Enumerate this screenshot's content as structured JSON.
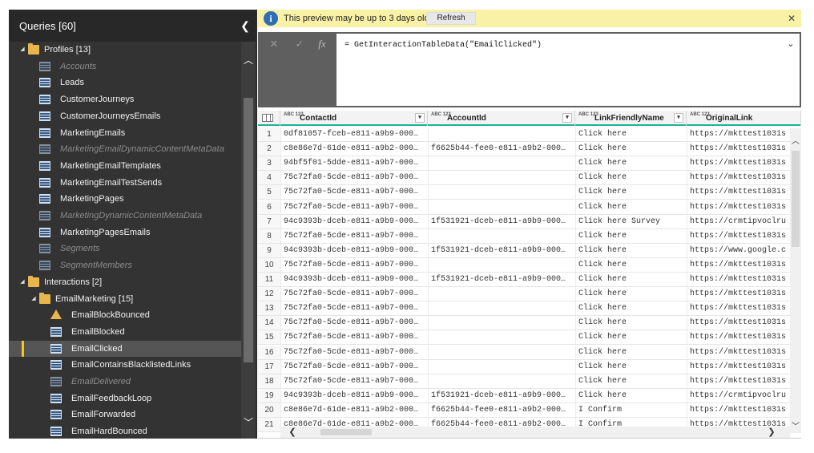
{
  "queries": {
    "title": "Queries [60]",
    "collapse_glyph": "❮",
    "items": [
      {
        "label": "Profiles [13]",
        "type": "folder",
        "depth": 0,
        "expanded": true,
        "disabled": false
      },
      {
        "label": "Accounts",
        "type": "table",
        "depth": 1,
        "disabled": true
      },
      {
        "label": "Leads",
        "type": "table",
        "depth": 1,
        "disabled": false
      },
      {
        "label": "CustomerJourneys",
        "type": "table",
        "depth": 1,
        "disabled": false
      },
      {
        "label": "CustomerJourneysEmails",
        "type": "table",
        "depth": 1,
        "disabled": false
      },
      {
        "label": "MarketingEmails",
        "type": "table",
        "depth": 1,
        "disabled": false
      },
      {
        "label": "MarketingEmailDynamicContentMetaData",
        "type": "table",
        "depth": 1,
        "disabled": true
      },
      {
        "label": "MarketingEmailTemplates",
        "type": "table",
        "depth": 1,
        "disabled": false
      },
      {
        "label": "MarketingEmailTestSends",
        "type": "table",
        "depth": 1,
        "disabled": false
      },
      {
        "label": "MarketingPages",
        "type": "table",
        "depth": 1,
        "disabled": false
      },
      {
        "label": "MarketingDynamicContentMetaData",
        "type": "table",
        "depth": 1,
        "disabled": true
      },
      {
        "label": "MarketingPagesEmails",
        "type": "table",
        "depth": 1,
        "disabled": false
      },
      {
        "label": "Segments",
        "type": "table",
        "depth": 1,
        "disabled": true
      },
      {
        "label": "SegmentMembers",
        "type": "table",
        "depth": 1,
        "disabled": true
      },
      {
        "label": "Interactions [2]",
        "type": "folder",
        "depth": 0,
        "expanded": true,
        "disabled": false
      },
      {
        "label": "EmailMarketing [15]",
        "type": "folder",
        "depth": 1,
        "expanded": true,
        "disabled": false
      },
      {
        "label": "EmailBlockBounced",
        "type": "warning",
        "depth": 2,
        "disabled": false
      },
      {
        "label": "EmailBlocked",
        "type": "table",
        "depth": 2,
        "disabled": false
      },
      {
        "label": "EmailClicked",
        "type": "table",
        "depth": 2,
        "disabled": false,
        "selected": true
      },
      {
        "label": "EmailContainsBlacklistedLinks",
        "type": "table",
        "depth": 2,
        "disabled": false
      },
      {
        "label": "EmailDelivered",
        "type": "table",
        "depth": 2,
        "disabled": true
      },
      {
        "label": "EmailFeedbackLoop",
        "type": "table",
        "depth": 2,
        "disabled": false
      },
      {
        "label": "EmailForwarded",
        "type": "table",
        "depth": 2,
        "disabled": false
      },
      {
        "label": "EmailHardBounced",
        "type": "table",
        "depth": 2,
        "disabled": false
      }
    ]
  },
  "infobar": {
    "icon": "info-icon",
    "icon_glyph": "i",
    "message": "This preview may be up to 3 days old.",
    "refresh_label": "Refresh",
    "close_glyph": "✕"
  },
  "formula": {
    "cancel_glyph": "✕",
    "commit_glyph": "✓",
    "fx_label": "fx",
    "text": "= GetInteractionTableData(\"EmailClicked\")",
    "expand_glyph": "⌄"
  },
  "grid": {
    "columns": [
      {
        "name": "ContactId",
        "type": "ABC 123"
      },
      {
        "name": "AccountId",
        "type": "ABC 123"
      },
      {
        "name": "LinkFriendlyName",
        "type": "ABC 123"
      },
      {
        "name": "OriginalLink",
        "type": "ABC 123"
      }
    ],
    "rows": [
      [
        "1",
        "0df81057-fceb-e811-a9b9-000…",
        "",
        "Click here",
        "https://mkttest1031s"
      ],
      [
        "2",
        "c8e86e7d-61de-e811-a9b2-000…",
        "f6625b44-fee0-e811-a9b2-000…",
        "Click here",
        "https://mkttest1031s"
      ],
      [
        "3",
        "94bf5f01-5dde-e811-a9b7-000…",
        "",
        "Click here",
        "https://mkttest1031s"
      ],
      [
        "4",
        "75c72fa0-5cde-e811-a9b7-000…",
        "",
        "Click here",
        "https://mkttest1031s"
      ],
      [
        "5",
        "75c72fa0-5cde-e811-a9b7-000…",
        "",
        "Click here",
        "https://mkttest1031s"
      ],
      [
        "6",
        "75c72fa0-5cde-e811-a9b7-000…",
        "",
        "Click here",
        "https://mkttest1031s"
      ],
      [
        "7",
        "94c9393b-dceb-e811-a9b9-000…",
        "1f531921-dceb-e811-a9b9-000…",
        "Click here Survey",
        "https://crmtipvoclru"
      ],
      [
        "8",
        "75c72fa0-5cde-e811-a9b7-000…",
        "",
        "Click here",
        "https://mkttest1031s"
      ],
      [
        "9",
        "94c9393b-dceb-e811-a9b9-000…",
        "1f531921-dceb-e811-a9b9-000…",
        "Click here",
        "https://www.google.c"
      ],
      [
        "10",
        "75c72fa0-5cde-e811-a9b7-000…",
        "",
        "Click here",
        "https://mkttest1031s"
      ],
      [
        "11",
        "94c9393b-dceb-e811-a9b9-000…",
        "1f531921-dceb-e811-a9b9-000…",
        "Click here",
        "https://mkttest1031s"
      ],
      [
        "12",
        "75c72fa0-5cde-e811-a9b7-000…",
        "",
        "Click here",
        "https://mkttest1031s"
      ],
      [
        "13",
        "75c72fa0-5cde-e811-a9b7-000…",
        "",
        "Click here",
        "https://mkttest1031s"
      ],
      [
        "14",
        "75c72fa0-5cde-e811-a9b7-000…",
        "",
        "Click here",
        "https://mkttest1031s"
      ],
      [
        "15",
        "75c72fa0-5cde-e811-a9b7-000…",
        "",
        "Click here",
        "https://mkttest1031s"
      ],
      [
        "16",
        "75c72fa0-5cde-e811-a9b7-000…",
        "",
        "Click here",
        "https://mkttest1031s"
      ],
      [
        "17",
        "75c72fa0-5cde-e811-a9b7-000…",
        "",
        "Click here",
        "https://mkttest1031s"
      ],
      [
        "18",
        "75c72fa0-5cde-e811-a9b7-000…",
        "",
        "Click here",
        "https://mkttest1031s"
      ],
      [
        "19",
        "94c9393b-dceb-e811-a9b9-000…",
        "1f531921-dceb-e811-a9b9-000…",
        "Click here",
        "https://crmtipvoclru"
      ],
      [
        "20",
        "c8e86e7d-61de-e811-a9b2-000…",
        "f6625b44-fee0-e811-a9b2-000…",
        "I Confirm",
        "https://mkttest1031s"
      ],
      [
        "21",
        "c8e86e7d-61de-e811-a9b2-000…",
        "f6625b44-fee0-e811-a9b2-000…",
        "I Confirm",
        "https://mkttest1031s"
      ]
    ],
    "colors": {
      "header_accent": "#1fb19d",
      "selected_bar": "#f2c811",
      "infobar_bg": "#f9f1a5"
    }
  }
}
